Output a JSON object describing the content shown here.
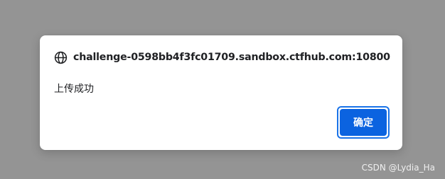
{
  "dialog": {
    "origin": "challenge-0598bb4f3fc01709.sandbox.ctfhub.com:10800",
    "origin_icon": "globe-icon",
    "message": "上传成功",
    "ok_label": "确定"
  },
  "watermark": "CSDN @Lydia_Ha",
  "colors": {
    "overlay": "#949494",
    "dialog_bg": "#ffffff",
    "button_bg": "#0b63e0",
    "button_focus_ring": "#1a73e8",
    "text": "#202124"
  }
}
